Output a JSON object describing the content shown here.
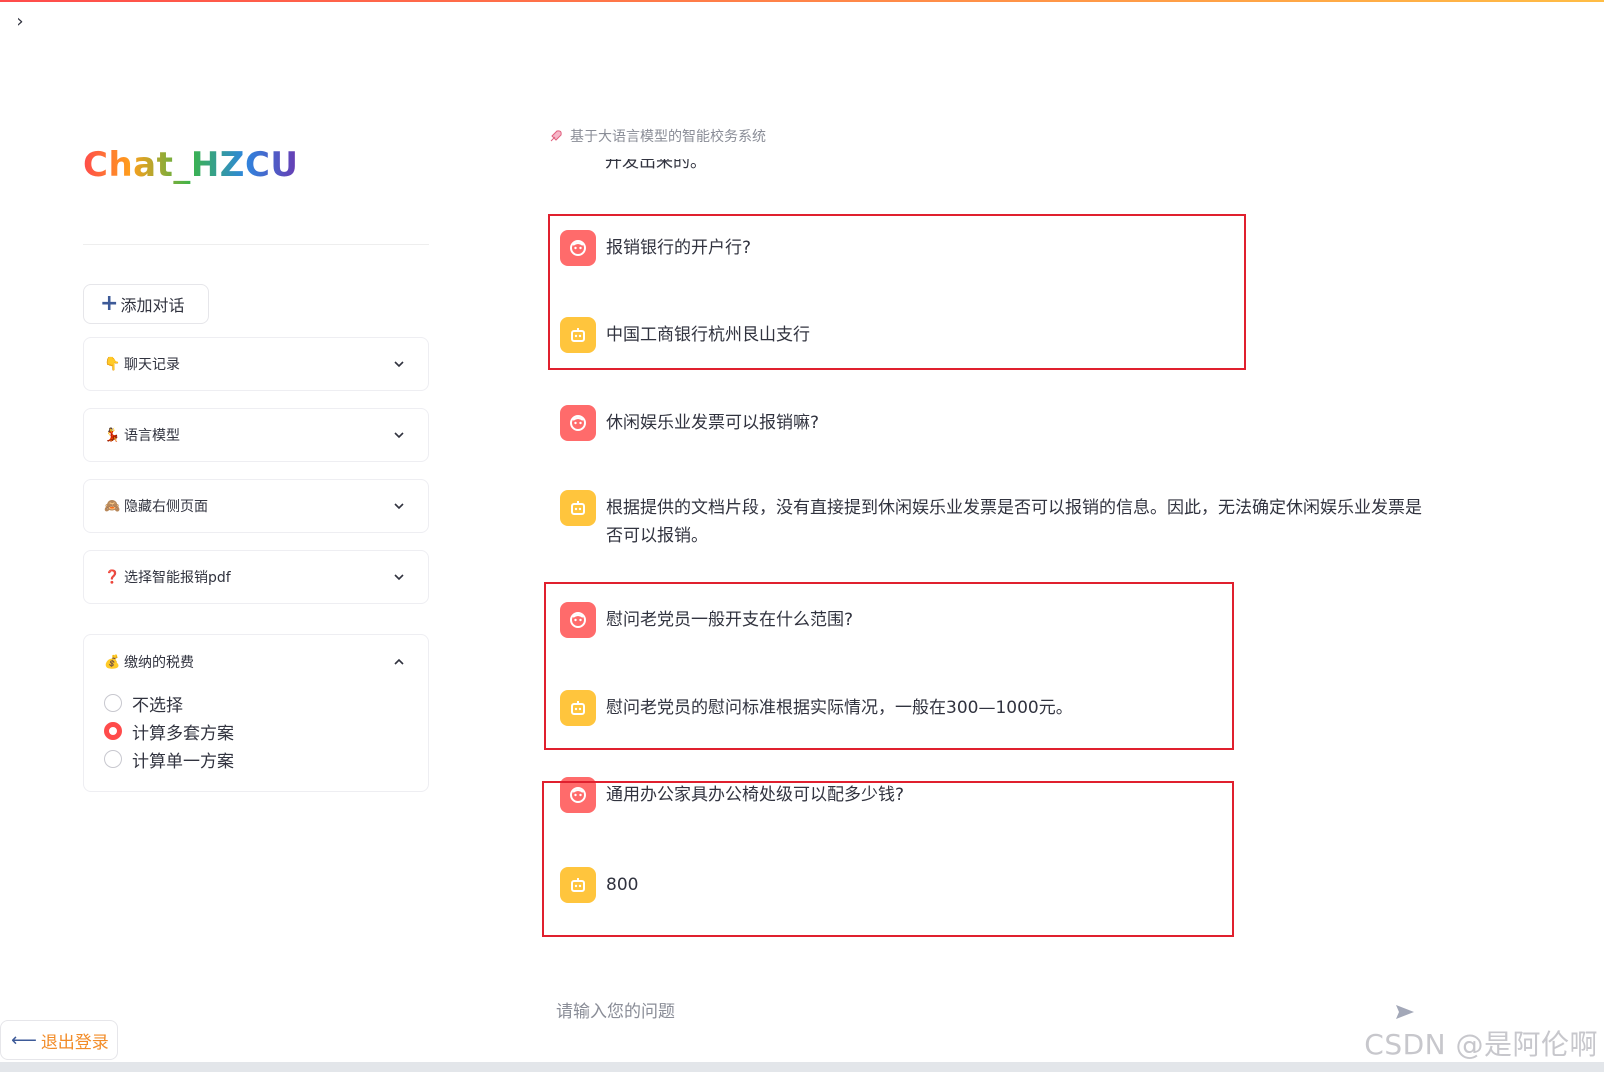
{
  "sidebar": {
    "app_title": "Chat_HZCU",
    "add_chat_label": "添加对话",
    "expanders": [
      {
        "emoji": "👇",
        "label": "聊天记录"
      },
      {
        "emoji": "💃",
        "label": "语言模型"
      },
      {
        "emoji": "🙈",
        "label": "隐藏右侧页面"
      },
      {
        "emoji": "❓",
        "label": "选择智能报销pdf"
      }
    ],
    "tax_expander": {
      "emoji": "💰",
      "label": "缴纳的税费",
      "options": [
        "不选择",
        "计算多套方案",
        "计算单一方案"
      ],
      "selected": "计算多套方案"
    },
    "logout_label": "退出登录"
  },
  "main": {
    "caption": "基于大语言模型的智能校务系统",
    "cut_text": "开发出来的。",
    "messages": [
      {
        "role": "user",
        "text": "报销银行的开户行?"
      },
      {
        "role": "bot",
        "text": "中国工商银行杭州艮山支行"
      },
      {
        "role": "user",
        "text": "休闲娱乐业发票可以报销嘛?"
      },
      {
        "role": "bot",
        "text": "根据提供的文档片段，没有直接提到休闲娱乐业发票是否可以报销的信息。因此，无法确定休闲娱乐业发票是否可以报销。"
      },
      {
        "role": "user",
        "text": "慰问老党员一般开支在什么范围?"
      },
      {
        "role": "bot",
        "text": "慰问老党员的慰问标准根据实际情况，一般在300—1000元。"
      },
      {
        "role": "user",
        "text": "通用办公家具办公椅处级可以配多少钱?"
      },
      {
        "role": "bot",
        "text": "800"
      }
    ],
    "input_placeholder": "请输入您的问题"
  },
  "watermark": "CSDN @是阿伦啊",
  "colors": {
    "accent": "#ff4b4b",
    "user_avatar": "#ff6b6b",
    "bot_avatar": "#ffc53d",
    "highlight_border": "#e0202e"
  }
}
